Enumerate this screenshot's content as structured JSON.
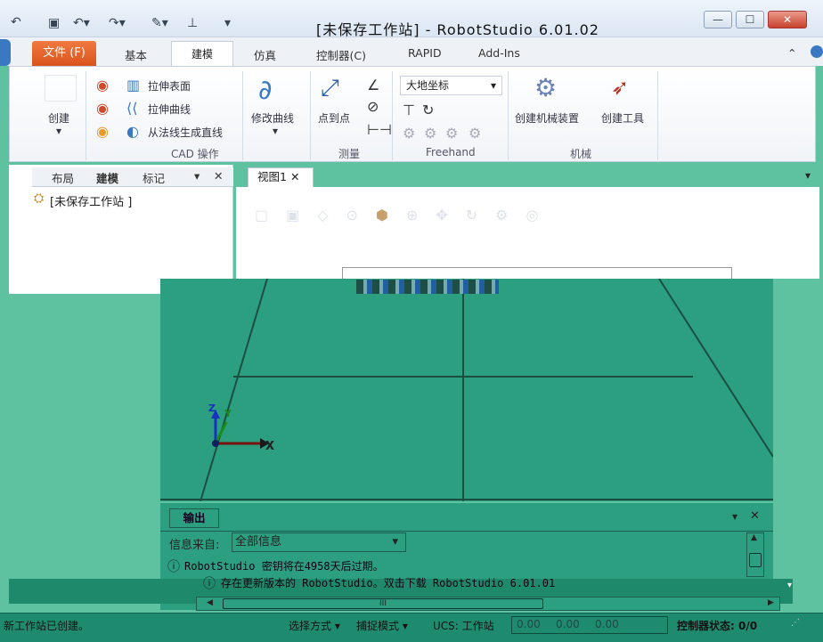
{
  "window": {
    "title": "[未保存工作站] - RobotStudio 6.01.02",
    "minimize": "—",
    "maximize": "☐",
    "close": "✕"
  },
  "tabs": [
    {
      "label": "文件 (F)"
    },
    {
      "label": "基本"
    },
    {
      "label": "建模"
    },
    {
      "label": "仿真"
    },
    {
      "label": "控制器(C)"
    },
    {
      "label": "RAPID"
    },
    {
      "label": "Add-Ins"
    }
  ],
  "ribbon": {
    "create": {
      "label": "创建"
    },
    "cad": {
      "items": [
        "拉伸表面",
        "拉伸曲线",
        "从法线生成直线"
      ],
      "group": "CAD 操作"
    },
    "modify_curve": "修改曲线",
    "measure": {
      "point_to_point": "点到点",
      "group": "测量"
    },
    "freehand": {
      "frame": "大地坐标",
      "group": "Freehand"
    },
    "mechanism": {
      "create_mechanism": "创建机械装置",
      "create_tool": "创建工具",
      "group": "机械"
    }
  },
  "left_panel": {
    "tabs": [
      "布局",
      "建模",
      "标记"
    ],
    "tree_item": "[未保存工作站 ]"
  },
  "view": {
    "tab": "视图1",
    "axes": {
      "x": "X",
      "y": "Y",
      "z": "Z"
    }
  },
  "output": {
    "tab": "输出",
    "filter_label": "信息来自:",
    "filter_value": "全部信息",
    "messages": [
      "RobotStudio 密钥将在4958天后过期。",
      "存在更新版本的 RobotStudio。双击下载 RobotStudio 6.01.01"
    ],
    "scroll_mark": "III"
  },
  "statusbar": {
    "message": "新工作站已创建。",
    "select_mode": "选择方式 ▾",
    "snap_mode": "捕捉模式 ▾",
    "ucs": "UCS: 工作站",
    "coords": [
      "0.00",
      "0.00",
      "0.00"
    ],
    "controller_status": "控制器状态: 0/0"
  },
  "colors": {
    "file_tab": "#e0632a",
    "view_bg": "#2b9f80",
    "tint": "#5ec2a0"
  }
}
